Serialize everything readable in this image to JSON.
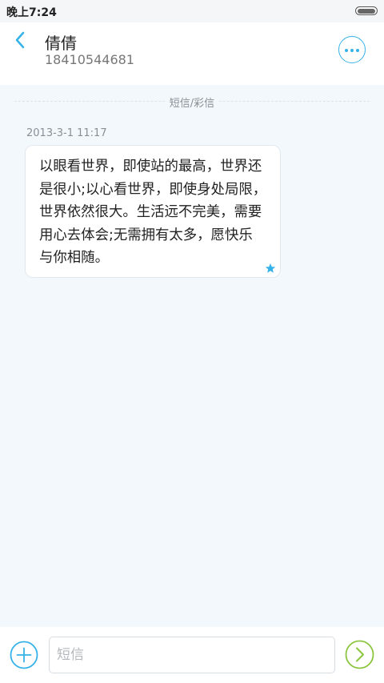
{
  "status_bar": {
    "time": "晚上7:24"
  },
  "header": {
    "contact_name": "倩倩",
    "contact_phone": "18410544681"
  },
  "divider": {
    "label": "短信/彩信"
  },
  "message": {
    "timestamp": "2013-3-1 11:17",
    "lines": [
      "以眼看世界，即使站的最高，世界还",
      "是很小;以心看世界，即使身处局限，",
      "世界依然很大。生活远不完美，需要",
      "用心去体会;无需拥有太多，愿快乐",
      "与你相随。"
    ]
  },
  "composer": {
    "placeholder": "短信"
  },
  "colors": {
    "accent": "#35b2e8",
    "send": "#8cc63e",
    "background": "#f3f8fd"
  },
  "icons": {
    "back": "chevron-left-icon",
    "more": "more-dots-icon",
    "star": "star-icon",
    "add": "plus-icon",
    "send": "send-chevron-icon"
  }
}
